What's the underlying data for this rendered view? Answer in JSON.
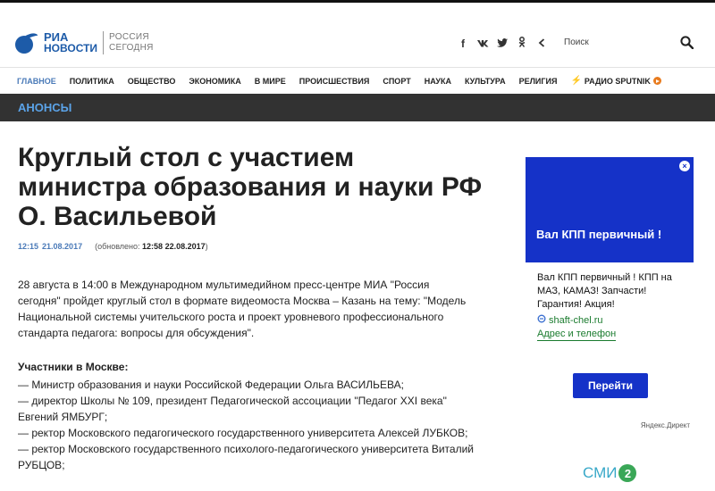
{
  "header": {
    "logo_ria": "РИА",
    "logo_novosti": "НОВОСТИ",
    "logo_rs_line1": "РОССИЯ",
    "logo_rs_line2": "СЕГОДНЯ",
    "socials": [
      "f",
      "vk",
      "twitter",
      "odnoklassniki",
      "share"
    ],
    "social_glyphs": [
      "f",
      "вк",
      "🐦",
      "ок",
      "<"
    ],
    "search_placeholder": "Поиск"
  },
  "nav": {
    "items": [
      "ГЛАВНОЕ",
      "ПОЛИТИКА",
      "ОБЩЕСТВО",
      "ЭКОНОМИКА",
      "В МИРЕ",
      "ПРОИСШЕСТВИЯ",
      "СПОРТ",
      "НАУКА",
      "КУЛЬТУРА",
      "РЕЛИГИЯ"
    ],
    "sputnik_label": "РАДИО SPUTNIK",
    "accent_color": "#4a7ab8",
    "sputnik_color": "#e87b1e"
  },
  "band": {
    "title": "АНОНСЫ",
    "color": "#5ba3e8",
    "bg": "#323232"
  },
  "article": {
    "title": "Круглый стол с участием министра образования и науки РФ О. Васильевой",
    "time": "12:15",
    "date": "21.08.2017",
    "updated_prefix": "(обновлено:",
    "updated_value": "12:58 22.08.2017",
    "updated_suffix": ")",
    "lead": "28 августа в 14:00 в Международном мультимедийном пресс-центре МИА \"Россия сегодня\" пройдет круглый стол в формате видеомоста Москва – Казань на тему: \"Модель Национальной системы учительского роста и проект уровневого профессионального стандарта педагога: вопросы для обсуждения\".",
    "participants_title": "Участники в Москве:",
    "participants": [
      "— Министр образования и науки Российской Федерации Ольга ВАСИЛЬЕВА;",
      "— директор Школы № 109, президент Педагогической ассоциации \"Педагог XXI века\" Евгений ЯМБУРГ;",
      "— ректор Московского педагогического государственного университета Алексей ЛУБКОВ;",
      "— ректор Московского государственного психолого-педагогического университета Виталий РУБЦОВ;"
    ]
  },
  "ad": {
    "close": "×",
    "top_title": "Вал КПП первичный !",
    "text": "Вал КПП первичный ! КПП на МАЗ, КАМАЗ! Запчасти! Гарантия! Акция!",
    "domain": "shaft-chel.ru",
    "link": "Адрес и телефон",
    "button": "Перейти",
    "source": "Яндекс.Директ",
    "color": "#1532c8"
  },
  "smi2": {
    "text": "СМИ",
    "badge": "2"
  }
}
